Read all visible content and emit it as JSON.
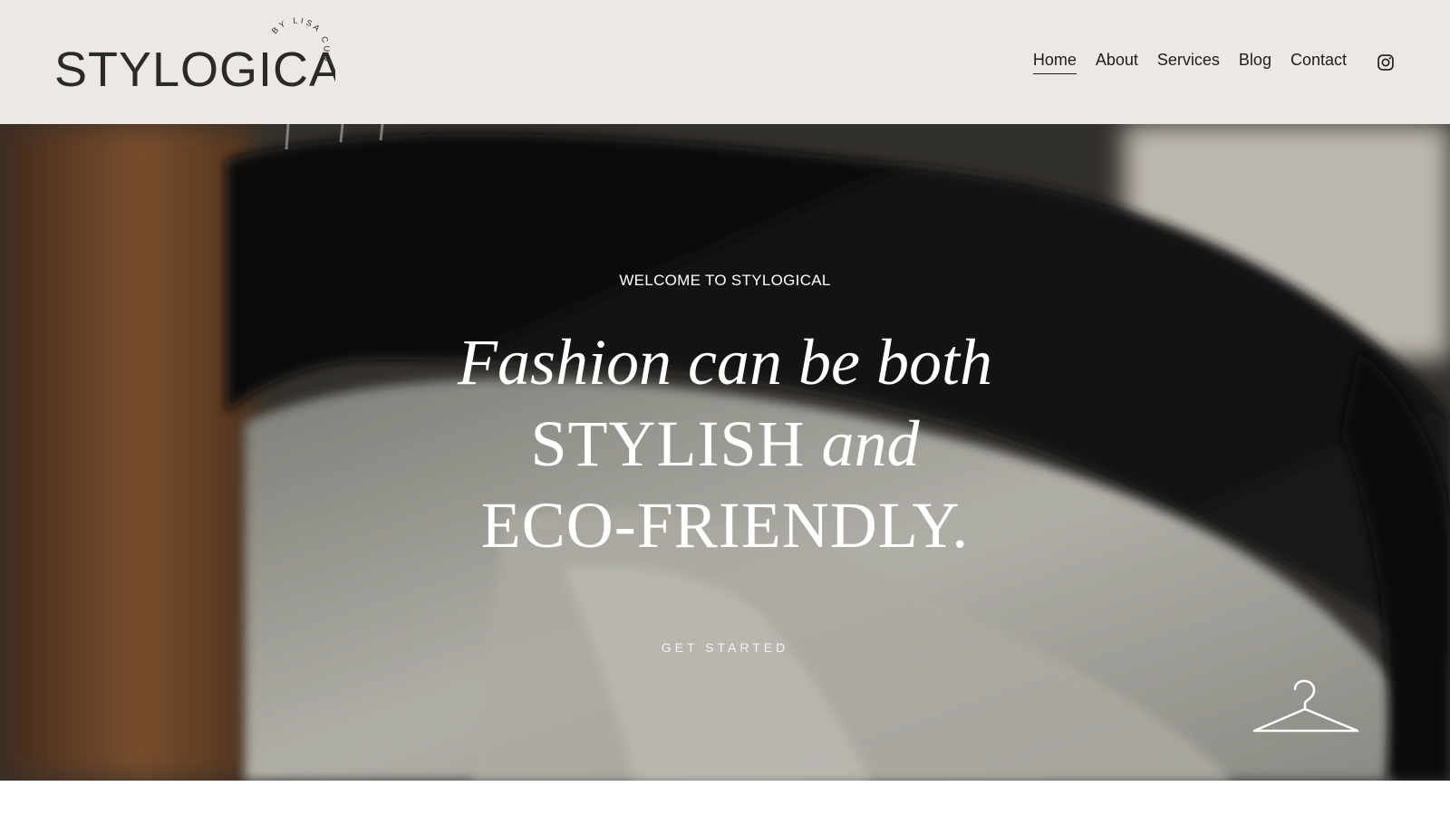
{
  "brand": {
    "logo_text": "STYLOGICAL",
    "logo_tagline": "BY LISA CURTIN"
  },
  "nav": {
    "items": [
      {
        "label": "Home",
        "active": true
      },
      {
        "label": "About",
        "active": false
      },
      {
        "label": "Services",
        "active": false
      },
      {
        "label": "Blog",
        "active": false
      },
      {
        "label": "Contact",
        "active": false
      }
    ],
    "social_icon": "instagram-icon"
  },
  "hero": {
    "eyebrow": "WELCOME TO STYLOGICAL",
    "headline_line1": "Fashion can be both",
    "headline_line2_main": "STYLISH",
    "headline_line2_italic": "and",
    "headline_line3": "ECO-FRIENDLY.",
    "cta_label": "GET STARTED",
    "decor_icon": "hanger-icon"
  },
  "colors": {
    "header_background": "#ece8e3",
    "text_dark": "#1d1d1d",
    "hero_text": "#ffffff"
  }
}
